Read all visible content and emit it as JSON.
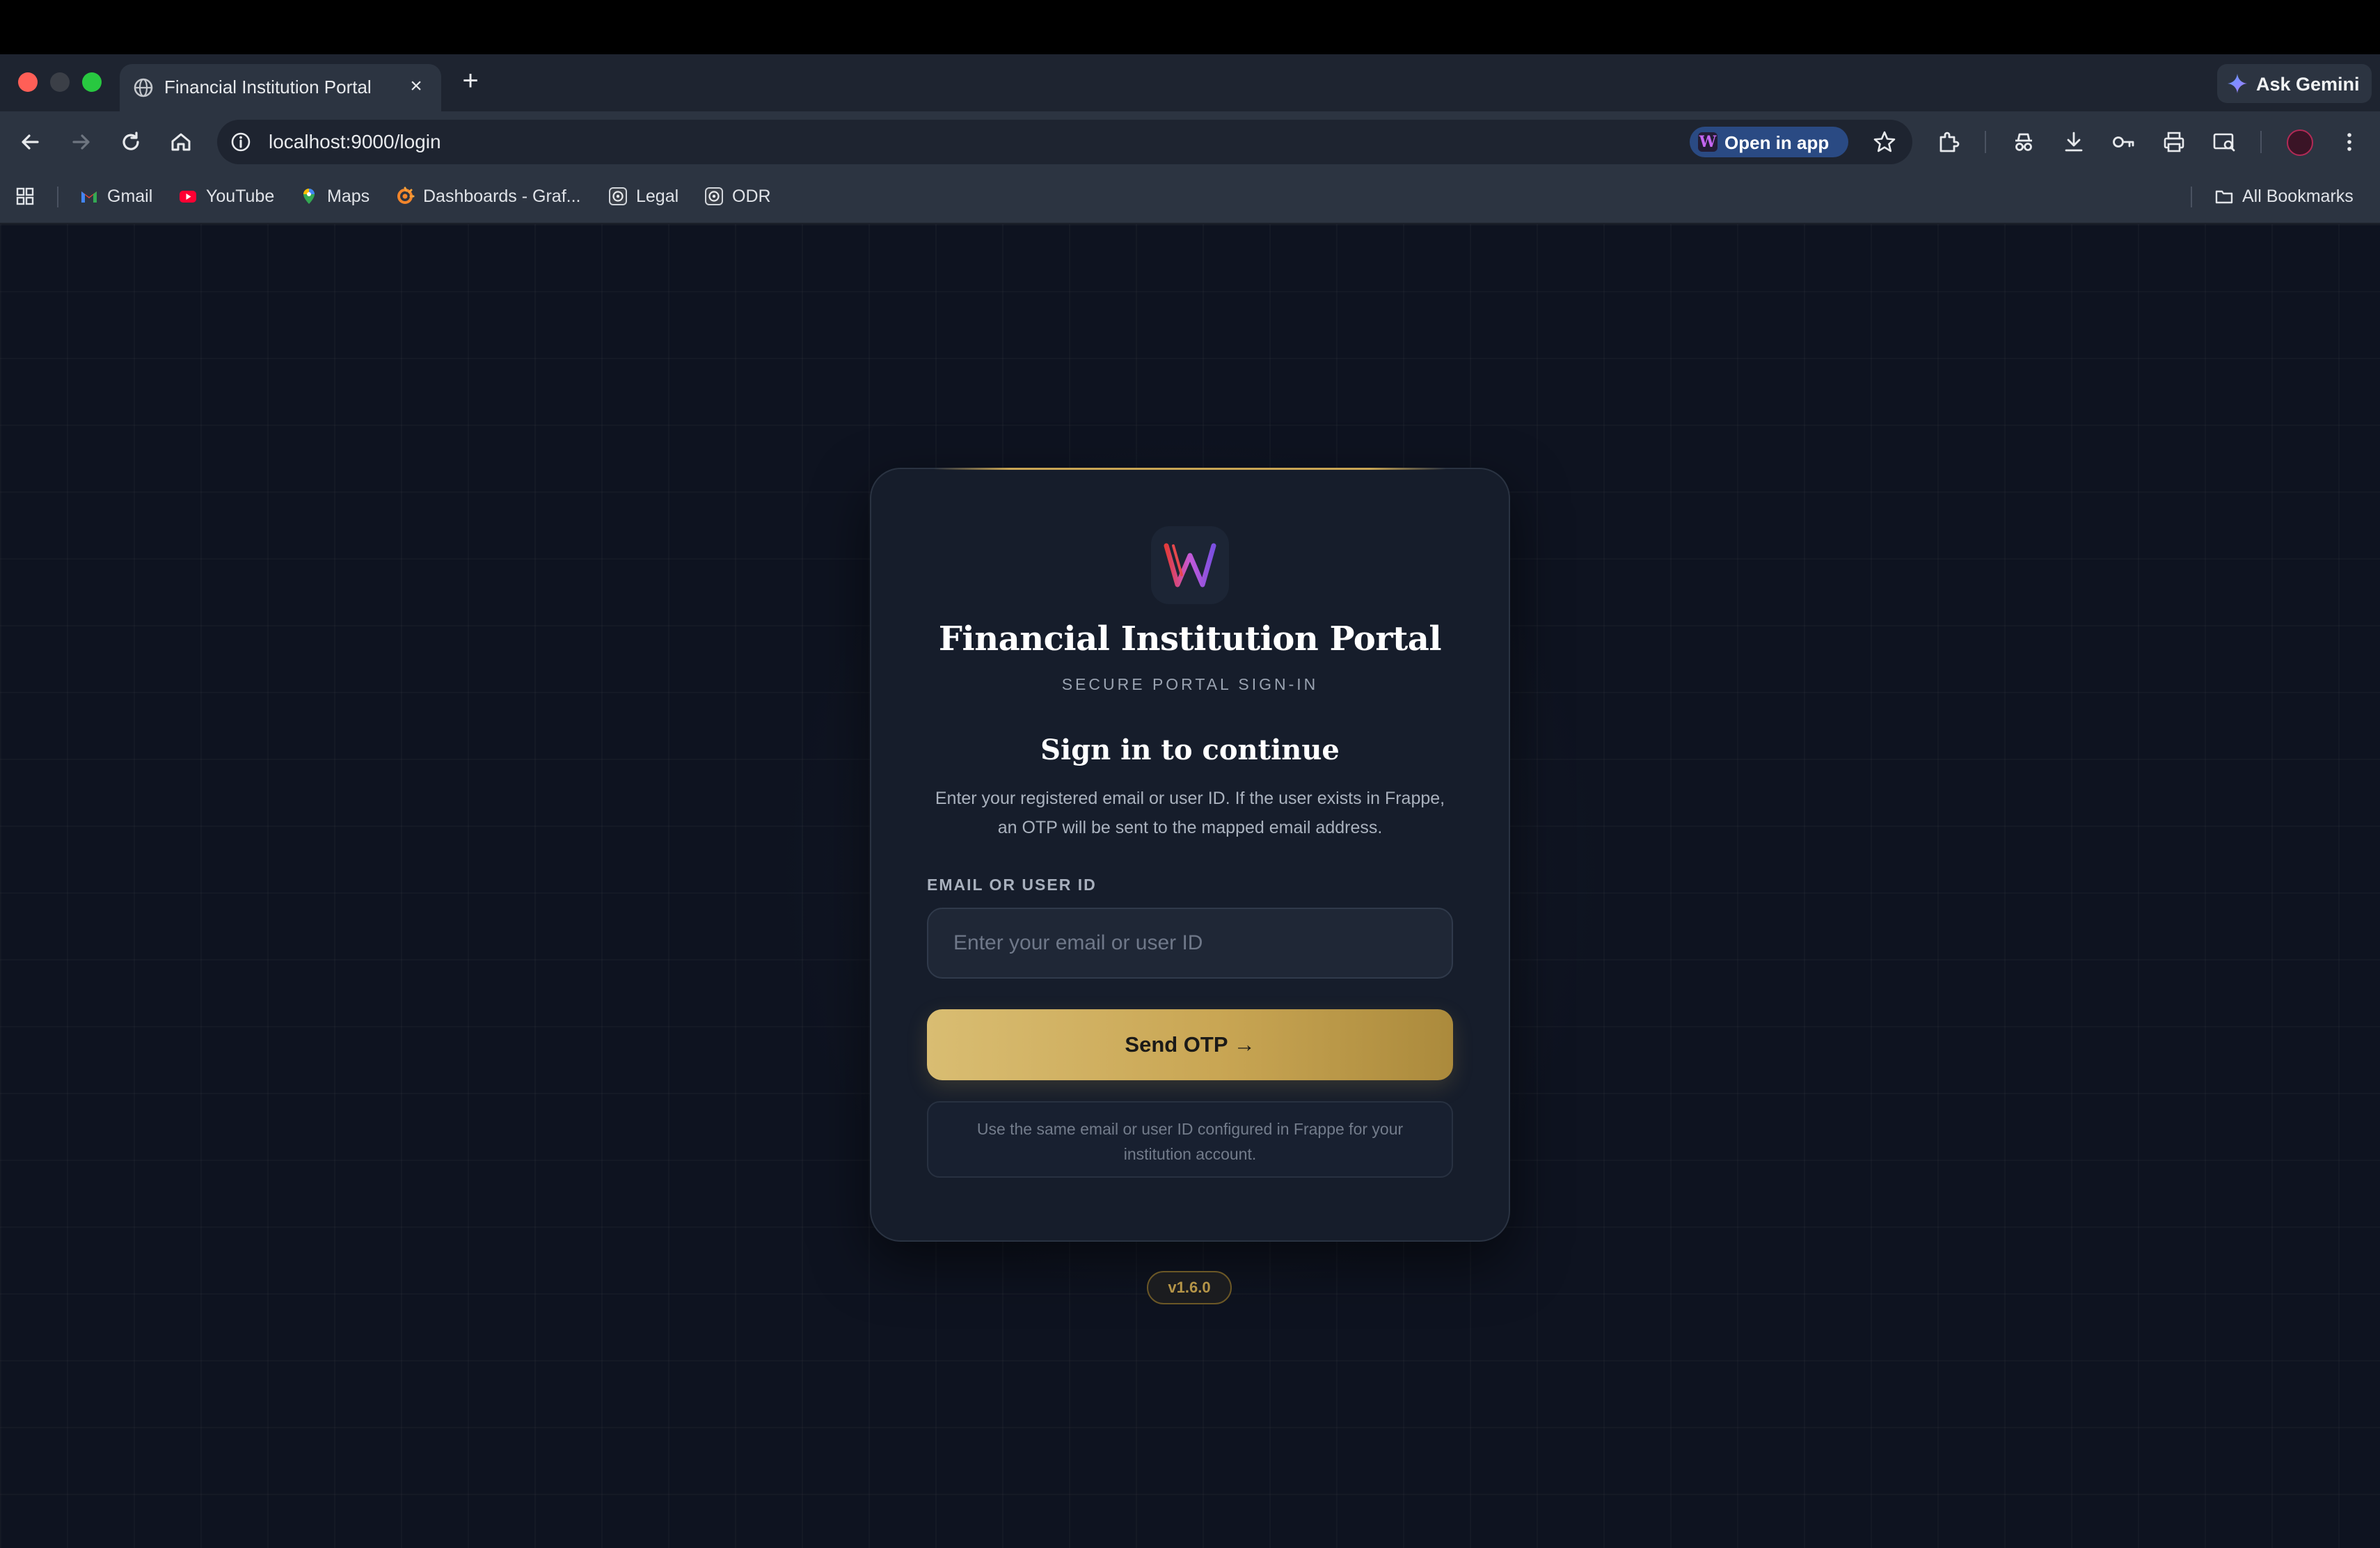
{
  "browser": {
    "tab_title": "Financial Institution Portal",
    "tab_close": "×",
    "new_tab": "+",
    "ask_gemini": "Ask Gemini",
    "url": "localhost:9000/login",
    "open_in_app": "Open in app",
    "open_in_app_logo": "W",
    "bookmarks": [
      {
        "label": "Gmail",
        "icon": "gmail-icon"
      },
      {
        "label": "YouTube",
        "icon": "youtube-icon"
      },
      {
        "label": "Maps",
        "icon": "maps-icon"
      },
      {
        "label": "Dashboards - Graf...",
        "icon": "grafana-icon"
      },
      {
        "label": "Legal",
        "icon": "legal-icon"
      },
      {
        "label": "ODR",
        "icon": "odr-icon"
      }
    ],
    "all_bookmarks": "All Bookmarks"
  },
  "login": {
    "portal_title": "Financial Institution Portal",
    "portal_subtitle": "SECURE PORTAL SIGN-IN",
    "heading": "Sign in to continue",
    "description": "Enter your registered email or user ID. If the user exists in Frappe, an OTP will be sent to the mapped email address.",
    "field_label": "EMAIL OR USER ID",
    "field_placeholder": "Enter your email or user ID",
    "field_value": "",
    "submit_label": "Send OTP →",
    "hint": "Use the same email or user ID configured in Frappe for your institution account.",
    "version": "v1.6.0"
  },
  "colors": {
    "accent_gold": "#c9a654",
    "background": "#0e1320",
    "card": "#161d2b"
  }
}
